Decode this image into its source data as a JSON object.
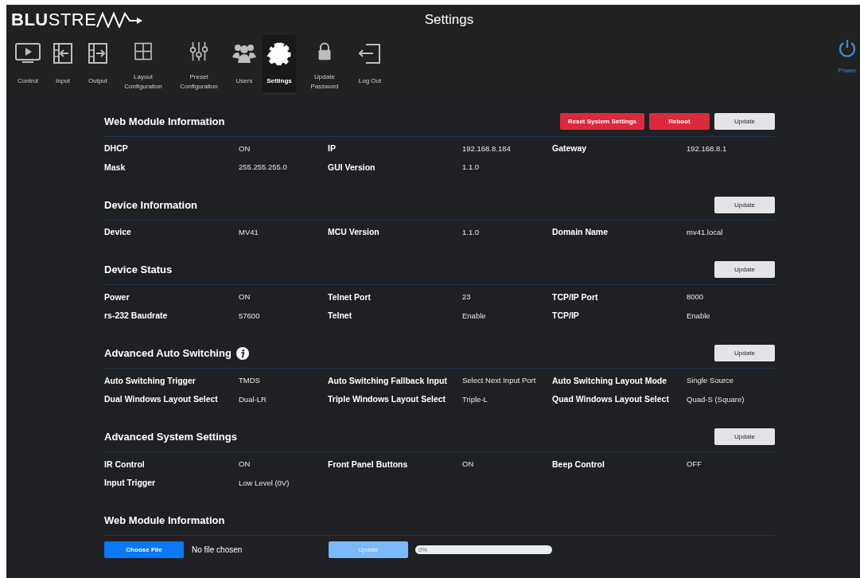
{
  "header": {
    "logo": "**BLU**STRE",
    "title": "Settings"
  },
  "nav": [
    {
      "label": "Control",
      "selected": false
    },
    {
      "label": "Input",
      "selected": false
    },
    {
      "label": "Output",
      "selected": false
    },
    {
      "label": "Layout Configuration",
      "selected": false
    },
    {
      "label": "Preset Configuration",
      "selected": false
    },
    {
      "label": "Users",
      "selected": false
    },
    {
      "label": "Settings",
      "selected": true
    },
    {
      "label": "Update Password",
      "selected": false
    },
    {
      "label": "Log Out",
      "selected": false
    }
  ],
  "power": {
    "label": "Power"
  },
  "sections": [
    {
      "kind": "fields",
      "title": "Web Module Information",
      "info": false,
      "buttons": [
        {
          "label": "Reset System Settings",
          "kind": "danger"
        },
        {
          "label": "Reboot",
          "kind": "danger"
        },
        {
          "label": "Update",
          "kind": "light"
        }
      ],
      "rows": [
        [
          {
            "label": "DHCP",
            "value": "ON"
          },
          {
            "label": "IP",
            "value": "192.168.8.184"
          },
          {
            "label": "Gateway",
            "value": "192.168.8.1"
          }
        ],
        [
          {
            "label": "Mask",
            "value": "255.255.255.0"
          },
          {
            "label": "GUI Version",
            "value": "1.1.0"
          }
        ]
      ]
    },
    {
      "kind": "fields",
      "title": "Device Information",
      "info": false,
      "buttons": [
        {
          "label": "Update",
          "kind": "light"
        }
      ],
      "rows": [
        [
          {
            "label": "Device",
            "value": "MV41"
          },
          {
            "label": "MCU Version",
            "value": "1.1.0"
          },
          {
            "label": "Domain Name",
            "value": "mv41.local"
          }
        ]
      ]
    },
    {
      "kind": "fields",
      "title": "Device Status",
      "info": false,
      "buttons": [
        {
          "label": "Update",
          "kind": "light"
        }
      ],
      "rows": [
        [
          {
            "label": "Power",
            "value": "ON"
          },
          {
            "label": "Telnet Port",
            "value": "23"
          },
          {
            "label": "TCP/IP Port",
            "value": "8000"
          }
        ],
        [
          {
            "label": "rs-232 Baudrate",
            "value": "57600"
          },
          {
            "label": "Telnet",
            "value": "Enable"
          },
          {
            "label": "TCP/IP",
            "value": "Enable"
          }
        ]
      ]
    },
    {
      "kind": "fields",
      "title": "Advanced Auto Switching",
      "info": true,
      "buttons": [
        {
          "label": "Update",
          "kind": "light"
        }
      ],
      "rows": [
        [
          {
            "label": "Auto Switching Trigger",
            "value": "TMDS"
          },
          {
            "label": "Auto Switching Fallback Input",
            "value": "Select Next Input Port"
          },
          {
            "label": "Auto Switching Layout Mode",
            "value": "Single Source"
          }
        ],
        [
          {
            "label": "Dual Windows Layout Select",
            "value": "Dual-LR"
          },
          {
            "label": "Triple Windows Layout Select",
            "value": "Triple-L"
          },
          {
            "label": "Quad Windows Layout Select",
            "value": "Quad-S (Square)"
          }
        ]
      ]
    },
    {
      "kind": "fields",
      "title": "Advanced System Settings",
      "info": false,
      "buttons": [
        {
          "label": "Update",
          "kind": "light"
        }
      ],
      "rows": [
        [
          {
            "label": "IR Control",
            "value": "ON"
          },
          {
            "label": "Front Panel Buttons",
            "value": "ON"
          },
          {
            "label": "Beep Control",
            "value": "OFF"
          }
        ],
        [
          {
            "label": "Input Trigger",
            "value": "Low Level (0V)"
          }
        ]
      ]
    },
    {
      "kind": "upload",
      "title": "Web Module Information",
      "info": false,
      "choose": "Choose File",
      "file_status": "No file chosen",
      "update": {
        "label": "Update",
        "disabled": true
      },
      "progress": {
        "level": 0,
        "reading": "0%"
      }
    }
  ]
}
